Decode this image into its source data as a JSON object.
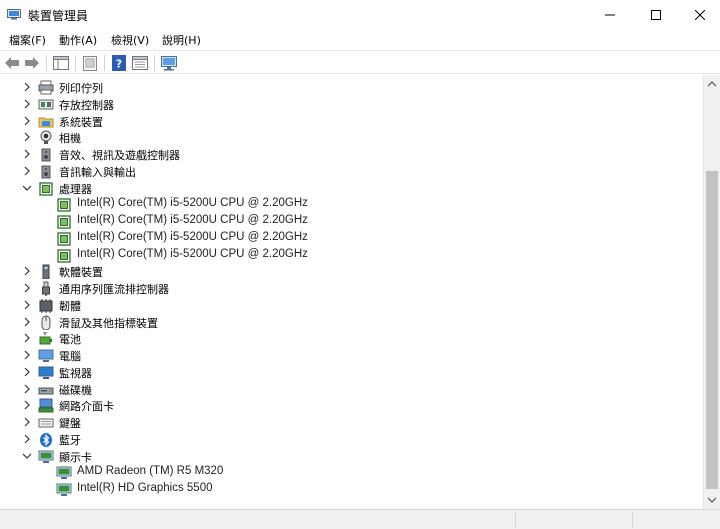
{
  "window": {
    "title": "裝置管理員",
    "app_icon": "device-manager-icon",
    "controls": [
      "minimize-icon",
      "maximize-icon",
      "close-icon"
    ]
  },
  "menu": [
    {
      "label": "檔案(F)"
    },
    {
      "label": "動作(A)"
    },
    {
      "label": "檢視(V)"
    },
    {
      "label": "說明(H)"
    }
  ],
  "toolbar": [
    "back-arrow-icon",
    "forward-arrow-icon",
    "show-hide-tree-icon",
    "properties-icon",
    "help-icon",
    "view-icon",
    "monitor-icon"
  ],
  "tree": [
    {
      "label": "列印佇列",
      "icon": "printer-icon",
      "expanded": false,
      "children": []
    },
    {
      "label": "存放控制器",
      "icon": "storage-controller-icon",
      "expanded": false,
      "children": []
    },
    {
      "label": "系統裝置",
      "icon": "system-folder-icon",
      "expanded": false,
      "children": []
    },
    {
      "label": "相機",
      "icon": "camera-icon",
      "expanded": false,
      "children": []
    },
    {
      "label": "音效、視訊及遊戲控制器",
      "icon": "speaker-icon",
      "expanded": false,
      "children": []
    },
    {
      "label": "音訊輸入與輸出",
      "icon": "speaker-icon",
      "expanded": false,
      "children": []
    },
    {
      "label": "處理器",
      "icon": "processor-icon",
      "expanded": true,
      "children": [
        {
          "label": "Intel(R) Core(TM) i5-5200U CPU @ 2.20GHz",
          "icon": "processor-icon"
        },
        {
          "label": "Intel(R) Core(TM) i5-5200U CPU @ 2.20GHz",
          "icon": "processor-icon"
        },
        {
          "label": "Intel(R) Core(TM) i5-5200U CPU @ 2.20GHz",
          "icon": "processor-icon"
        },
        {
          "label": "Intel(R) Core(TM) i5-5200U CPU @ 2.20GHz",
          "icon": "processor-icon"
        }
      ]
    },
    {
      "label": "軟體裝置",
      "icon": "software-device-icon",
      "expanded": false,
      "children": []
    },
    {
      "label": "通用序列匯流排控制器",
      "icon": "usb-icon",
      "expanded": false,
      "children": []
    },
    {
      "label": "韌體",
      "icon": "firmware-icon",
      "expanded": false,
      "children": []
    },
    {
      "label": "滑鼠及其他指標裝置",
      "icon": "mouse-icon",
      "expanded": false,
      "children": []
    },
    {
      "label": "電池",
      "icon": "battery-icon",
      "expanded": false,
      "children": []
    },
    {
      "label": "電腦",
      "icon": "computer-icon",
      "expanded": false,
      "children": []
    },
    {
      "label": "監視器",
      "icon": "monitor-icon",
      "expanded": false,
      "children": []
    },
    {
      "label": "磁碟機",
      "icon": "disk-drive-icon",
      "expanded": false,
      "children": []
    },
    {
      "label": "網路介面卡",
      "icon": "network-adapter-icon",
      "expanded": false,
      "children": []
    },
    {
      "label": "鍵盤",
      "icon": "keyboard-icon",
      "expanded": false,
      "children": []
    },
    {
      "label": "藍牙",
      "icon": "bluetooth-icon",
      "expanded": false,
      "children": []
    },
    {
      "label": "顯示卡",
      "icon": "display-adapter-icon",
      "expanded": true,
      "children": [
        {
          "label": "AMD Radeon (TM) R5 M320",
          "icon": "display-adapter-icon"
        },
        {
          "label": "Intel(R) HD Graphics 5500",
          "icon": "display-adapter-icon"
        }
      ]
    }
  ]
}
